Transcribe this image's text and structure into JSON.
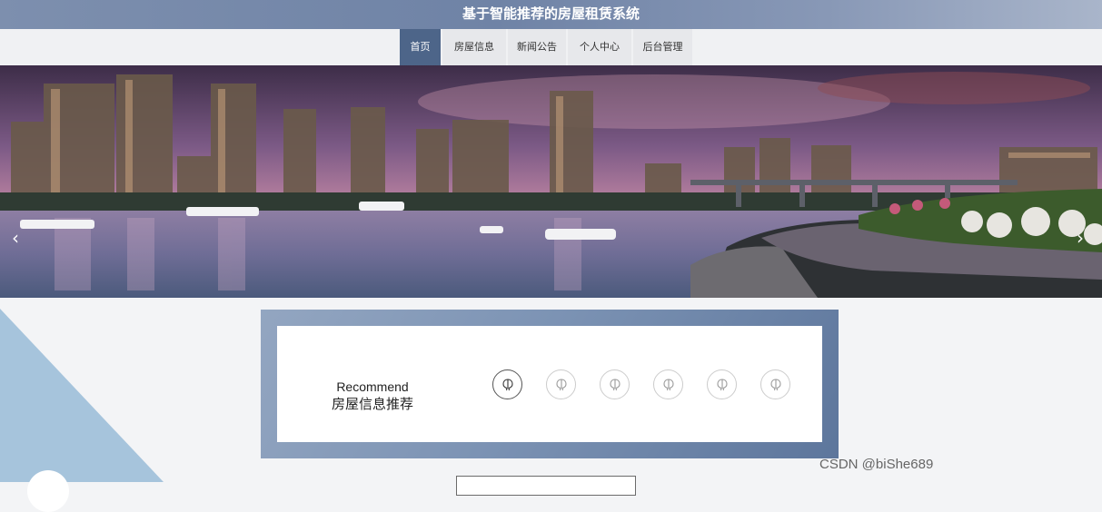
{
  "app": {
    "title": "基于智能推荐的房屋租赁系统"
  },
  "nav": {
    "items": [
      {
        "label": "首页",
        "active": true
      },
      {
        "label": "房屋信息",
        "active": false
      },
      {
        "label": "新闻公告",
        "active": false
      },
      {
        "label": "个人中心",
        "active": false
      },
      {
        "label": "后台管理",
        "active": false
      }
    ]
  },
  "banner": {
    "prev_icon": "chevron-left-icon",
    "next_icon": "chevron-right-icon"
  },
  "recommend": {
    "title_en": "Recommend",
    "title_cn": "房屋信息推荐",
    "dots_count": 6,
    "active_dot": 0,
    "dot_icon": "balloon-icon"
  },
  "watermark": "CSDN @biShe689",
  "colors": {
    "title_bar": "#7d8fae",
    "nav_active": "#4d6589",
    "recommend_bg": "#7c93b4"
  }
}
